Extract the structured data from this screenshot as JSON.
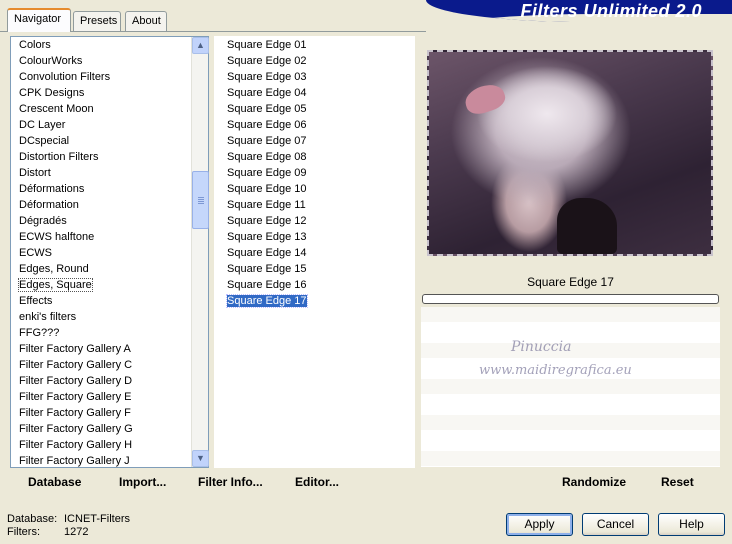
{
  "tabs": {
    "navigator": "Navigator",
    "presets": "Presets",
    "about": "About"
  },
  "banner": {
    "title": "Filters Unlimited 2.0"
  },
  "categories": [
    "Colors",
    "ColourWorks",
    "Convolution Filters",
    "CPK Designs",
    "Crescent Moon",
    "DC Layer",
    "DCspecial",
    "Distortion Filters",
    "Distort",
    "Déformations",
    "Déformation",
    "Dégradés",
    "ECWS halftone",
    "ECWS",
    "Edges, Round",
    "Edges, Square",
    "Effects",
    "enki's filters",
    "FFG???",
    "Filter Factory Gallery A",
    "Filter Factory Gallery C",
    "Filter Factory Gallery D",
    "Filter Factory Gallery E",
    "Filter Factory Gallery F",
    "Filter Factory Gallery G",
    "Filter Factory Gallery H",
    "Filter Factory Gallery J"
  ],
  "selected_category": "Edges, Square",
  "filters": [
    "Square Edge 01",
    "Square Edge 02",
    "Square Edge 03",
    "Square Edge 04",
    "Square Edge 05",
    "Square Edge 06",
    "Square Edge 07",
    "Square Edge 08",
    "Square Edge 09",
    "Square Edge 10",
    "Square Edge 11",
    "Square Edge 12",
    "Square Edge 13",
    "Square Edge 14",
    "Square Edge 15",
    "Square Edge 16",
    "Square Edge 17"
  ],
  "selected_filter": "Square Edge 17",
  "preview": {
    "caption": "Square Edge 17",
    "progress": 0,
    "watermark_name": "Pinuccia",
    "watermark_url": "www.maidiregrafica.eu"
  },
  "link_buttons": {
    "database": "Database",
    "import": "Import...",
    "filter_info": "Filter Info...",
    "editor": "Editor..."
  },
  "action_buttons": {
    "randomize": "Randomize",
    "reset": "Reset"
  },
  "info": {
    "database_label": "Database:",
    "database_value": "ICNET-Filters",
    "filters_label": "Filters:",
    "filters_value": "1272"
  },
  "dialog_buttons": {
    "apply": "Apply",
    "cancel": "Cancel",
    "help": "Help"
  },
  "colors": {
    "selection": "#316ac5",
    "banner": "#0a1a8c",
    "window_bg": "#ece9d8"
  }
}
